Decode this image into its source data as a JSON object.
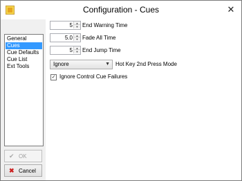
{
  "window": {
    "title": "Configuration - Cues",
    "close_glyph": "✕"
  },
  "sidebar": {
    "items": [
      {
        "label": "General",
        "selected": false
      },
      {
        "label": "Cues",
        "selected": true
      },
      {
        "label": "Cue Defaults",
        "selected": false
      },
      {
        "label": "Cue List",
        "selected": false
      },
      {
        "label": "Ext Tools",
        "selected": false
      }
    ]
  },
  "settings": {
    "end_warning_time": {
      "value": "5",
      "label": "End Warning Time"
    },
    "fade_all_time": {
      "value": "5.0",
      "label": "Fade All Time"
    },
    "end_jump_time": {
      "value": "5",
      "label": "End Jump Time"
    },
    "hotkey_mode": {
      "value": "Ignore",
      "label": "Hot Key 2nd Press Mode"
    },
    "ignore_control_failures": {
      "checked": true,
      "label": "Ignore Control Cue Failures"
    }
  },
  "buttons": {
    "ok_label": "OK",
    "cancel_label": "Cancel"
  },
  "colors": {
    "selection": "#3399ff",
    "cancel_icon": "#cc1f1f"
  }
}
